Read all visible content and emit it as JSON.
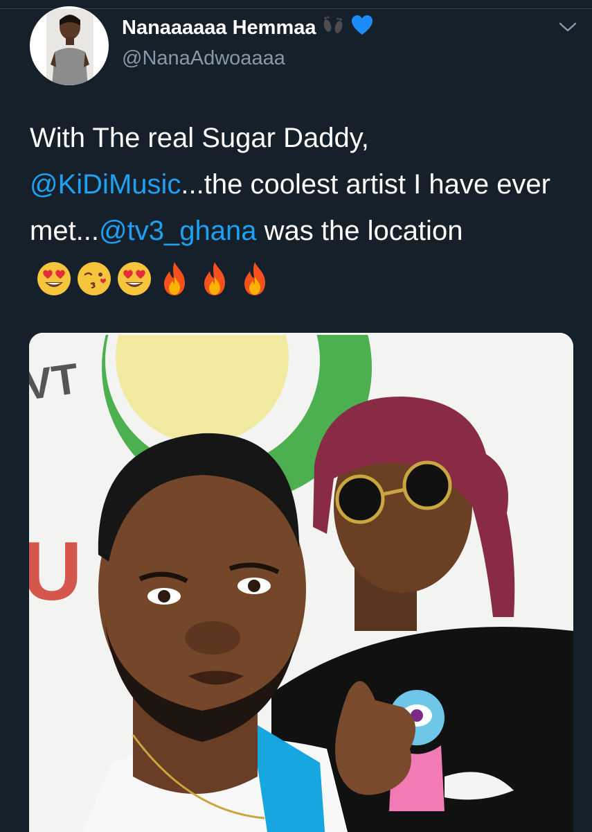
{
  "tweet": {
    "author": {
      "display_name": "Nanaaaaaa Hemmaa",
      "handle": "@NanaAdwoaaaa",
      "name_emojis": [
        "footprints-icon",
        "blue-heart-icon"
      ]
    },
    "text": {
      "part1": "With The real Sugar Daddy, ",
      "mention1": "@KiDiMusic",
      "part2": "...the coolest artist I have ever met...",
      "mention2": "@tv3_ghana",
      "part3": " was the location",
      "emojis": [
        "heart-eyes-emoji",
        "kissing-face-emoji",
        "heart-eyes-emoji",
        "fire-emoji",
        "fire-emoji",
        "fire-emoji"
      ]
    },
    "media": {
      "wall_text": "VT",
      "wall_text_2": "U"
    }
  },
  "colors": {
    "background": "#15202b",
    "text": "#ffffff",
    "secondary_text": "#8899a6",
    "link": "#1da1f2",
    "heart": "#1d8cf8"
  }
}
